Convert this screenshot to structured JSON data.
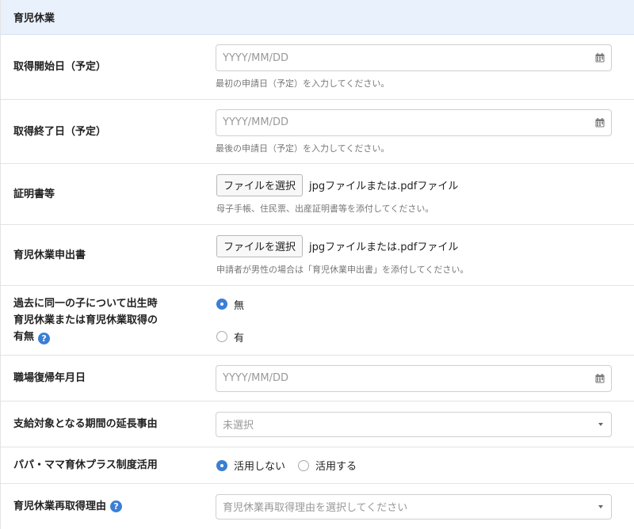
{
  "section": {
    "title": "育児休業"
  },
  "leave_start": {
    "label": "取得開始日（予定）",
    "placeholder": "YYYY/MM/DD",
    "help": "最初の申請日（予定）を入力してください。"
  },
  "leave_end": {
    "label": "取得終了日（予定）",
    "placeholder": "YYYY/MM/DD",
    "help": "最後の申請日（予定）を入力してください。"
  },
  "certificate": {
    "label": "証明書等",
    "button": "ファイルを選択",
    "status": "jpgファイルまたは.pdfファイル",
    "help": "母子手帳、住民票、出産証明書等を添付してください。"
  },
  "application": {
    "label": "育児休業申出書",
    "button": "ファイルを選択",
    "status": "jpgファイルまたは.pdfファイル",
    "help": "申請者が男性の場合は「育児休業申出書」を添付してください。"
  },
  "past_leave": {
    "label_line1": "過去に同一の子について出生時",
    "label_line2": "育児休業または育児休業取得の",
    "label_line3": "有無",
    "help_icon": "?",
    "options": [
      {
        "label": "無",
        "checked": true
      },
      {
        "label": "有",
        "checked": false
      }
    ]
  },
  "return_date": {
    "label": "職場復帰年月日",
    "placeholder": "YYYY/MM/DD"
  },
  "extension_reason": {
    "label": "支給対象となる期間の延長事由",
    "value": "未選択"
  },
  "papa_mama": {
    "label": "パパ・ママ育休プラス制度活用",
    "options": [
      {
        "label": "活用しない",
        "checked": true
      },
      {
        "label": "活用する",
        "checked": false
      }
    ]
  },
  "reacquire_reason": {
    "label": "育児休業再取得理由",
    "help_icon": "?",
    "value": "育児休業再取得理由を選択してください"
  },
  "icons": {
    "calendar": "calendar-icon",
    "help": "question-circle-icon",
    "caret": "chevron-down-icon"
  },
  "colors": {
    "header_bg": "#e8f1fc",
    "accent": "#3a7fd5",
    "border": "#e3e3e3"
  }
}
